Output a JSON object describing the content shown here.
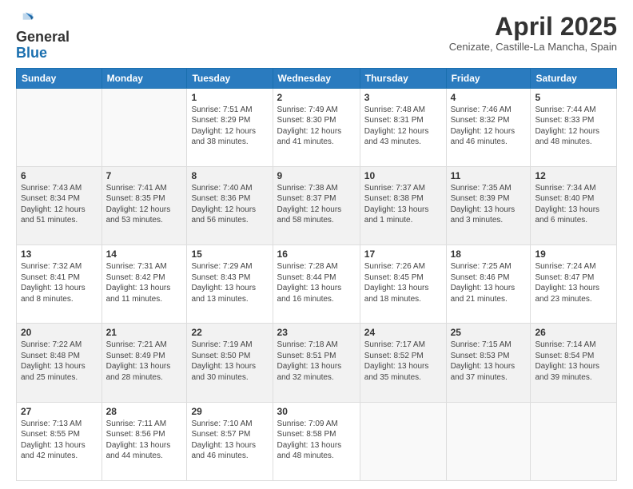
{
  "header": {
    "logo_general": "General",
    "logo_blue": "Blue",
    "month_title": "April 2025",
    "location": "Cenizate, Castille-La Mancha, Spain"
  },
  "weekdays": [
    "Sunday",
    "Monday",
    "Tuesday",
    "Wednesday",
    "Thursday",
    "Friday",
    "Saturday"
  ],
  "weeks": [
    [
      {
        "day": "",
        "sunrise": "",
        "sunset": "",
        "daylight": ""
      },
      {
        "day": "",
        "sunrise": "",
        "sunset": "",
        "daylight": ""
      },
      {
        "day": "1",
        "sunrise": "Sunrise: 7:51 AM",
        "sunset": "Sunset: 8:29 PM",
        "daylight": "Daylight: 12 hours and 38 minutes."
      },
      {
        "day": "2",
        "sunrise": "Sunrise: 7:49 AM",
        "sunset": "Sunset: 8:30 PM",
        "daylight": "Daylight: 12 hours and 41 minutes."
      },
      {
        "day": "3",
        "sunrise": "Sunrise: 7:48 AM",
        "sunset": "Sunset: 8:31 PM",
        "daylight": "Daylight: 12 hours and 43 minutes."
      },
      {
        "day": "4",
        "sunrise": "Sunrise: 7:46 AM",
        "sunset": "Sunset: 8:32 PM",
        "daylight": "Daylight: 12 hours and 46 minutes."
      },
      {
        "day": "5",
        "sunrise": "Sunrise: 7:44 AM",
        "sunset": "Sunset: 8:33 PM",
        "daylight": "Daylight: 12 hours and 48 minutes."
      }
    ],
    [
      {
        "day": "6",
        "sunrise": "Sunrise: 7:43 AM",
        "sunset": "Sunset: 8:34 PM",
        "daylight": "Daylight: 12 hours and 51 minutes."
      },
      {
        "day": "7",
        "sunrise": "Sunrise: 7:41 AM",
        "sunset": "Sunset: 8:35 PM",
        "daylight": "Daylight: 12 hours and 53 minutes."
      },
      {
        "day": "8",
        "sunrise": "Sunrise: 7:40 AM",
        "sunset": "Sunset: 8:36 PM",
        "daylight": "Daylight: 12 hours and 56 minutes."
      },
      {
        "day": "9",
        "sunrise": "Sunrise: 7:38 AM",
        "sunset": "Sunset: 8:37 PM",
        "daylight": "Daylight: 12 hours and 58 minutes."
      },
      {
        "day": "10",
        "sunrise": "Sunrise: 7:37 AM",
        "sunset": "Sunset: 8:38 PM",
        "daylight": "Daylight: 13 hours and 1 minute."
      },
      {
        "day": "11",
        "sunrise": "Sunrise: 7:35 AM",
        "sunset": "Sunset: 8:39 PM",
        "daylight": "Daylight: 13 hours and 3 minutes."
      },
      {
        "day": "12",
        "sunrise": "Sunrise: 7:34 AM",
        "sunset": "Sunset: 8:40 PM",
        "daylight": "Daylight: 13 hours and 6 minutes."
      }
    ],
    [
      {
        "day": "13",
        "sunrise": "Sunrise: 7:32 AM",
        "sunset": "Sunset: 8:41 PM",
        "daylight": "Daylight: 13 hours and 8 minutes."
      },
      {
        "day": "14",
        "sunrise": "Sunrise: 7:31 AM",
        "sunset": "Sunset: 8:42 PM",
        "daylight": "Daylight: 13 hours and 11 minutes."
      },
      {
        "day": "15",
        "sunrise": "Sunrise: 7:29 AM",
        "sunset": "Sunset: 8:43 PM",
        "daylight": "Daylight: 13 hours and 13 minutes."
      },
      {
        "day": "16",
        "sunrise": "Sunrise: 7:28 AM",
        "sunset": "Sunset: 8:44 PM",
        "daylight": "Daylight: 13 hours and 16 minutes."
      },
      {
        "day": "17",
        "sunrise": "Sunrise: 7:26 AM",
        "sunset": "Sunset: 8:45 PM",
        "daylight": "Daylight: 13 hours and 18 minutes."
      },
      {
        "day": "18",
        "sunrise": "Sunrise: 7:25 AM",
        "sunset": "Sunset: 8:46 PM",
        "daylight": "Daylight: 13 hours and 21 minutes."
      },
      {
        "day": "19",
        "sunrise": "Sunrise: 7:24 AM",
        "sunset": "Sunset: 8:47 PM",
        "daylight": "Daylight: 13 hours and 23 minutes."
      }
    ],
    [
      {
        "day": "20",
        "sunrise": "Sunrise: 7:22 AM",
        "sunset": "Sunset: 8:48 PM",
        "daylight": "Daylight: 13 hours and 25 minutes."
      },
      {
        "day": "21",
        "sunrise": "Sunrise: 7:21 AM",
        "sunset": "Sunset: 8:49 PM",
        "daylight": "Daylight: 13 hours and 28 minutes."
      },
      {
        "day": "22",
        "sunrise": "Sunrise: 7:19 AM",
        "sunset": "Sunset: 8:50 PM",
        "daylight": "Daylight: 13 hours and 30 minutes."
      },
      {
        "day": "23",
        "sunrise": "Sunrise: 7:18 AM",
        "sunset": "Sunset: 8:51 PM",
        "daylight": "Daylight: 13 hours and 32 minutes."
      },
      {
        "day": "24",
        "sunrise": "Sunrise: 7:17 AM",
        "sunset": "Sunset: 8:52 PM",
        "daylight": "Daylight: 13 hours and 35 minutes."
      },
      {
        "day": "25",
        "sunrise": "Sunrise: 7:15 AM",
        "sunset": "Sunset: 8:53 PM",
        "daylight": "Daylight: 13 hours and 37 minutes."
      },
      {
        "day": "26",
        "sunrise": "Sunrise: 7:14 AM",
        "sunset": "Sunset: 8:54 PM",
        "daylight": "Daylight: 13 hours and 39 minutes."
      }
    ],
    [
      {
        "day": "27",
        "sunrise": "Sunrise: 7:13 AM",
        "sunset": "Sunset: 8:55 PM",
        "daylight": "Daylight: 13 hours and 42 minutes."
      },
      {
        "day": "28",
        "sunrise": "Sunrise: 7:11 AM",
        "sunset": "Sunset: 8:56 PM",
        "daylight": "Daylight: 13 hours and 44 minutes."
      },
      {
        "day": "29",
        "sunrise": "Sunrise: 7:10 AM",
        "sunset": "Sunset: 8:57 PM",
        "daylight": "Daylight: 13 hours and 46 minutes."
      },
      {
        "day": "30",
        "sunrise": "Sunrise: 7:09 AM",
        "sunset": "Sunset: 8:58 PM",
        "daylight": "Daylight: 13 hours and 48 minutes."
      },
      {
        "day": "",
        "sunrise": "",
        "sunset": "",
        "daylight": ""
      },
      {
        "day": "",
        "sunrise": "",
        "sunset": "",
        "daylight": ""
      },
      {
        "day": "",
        "sunrise": "",
        "sunset": "",
        "daylight": ""
      }
    ]
  ]
}
